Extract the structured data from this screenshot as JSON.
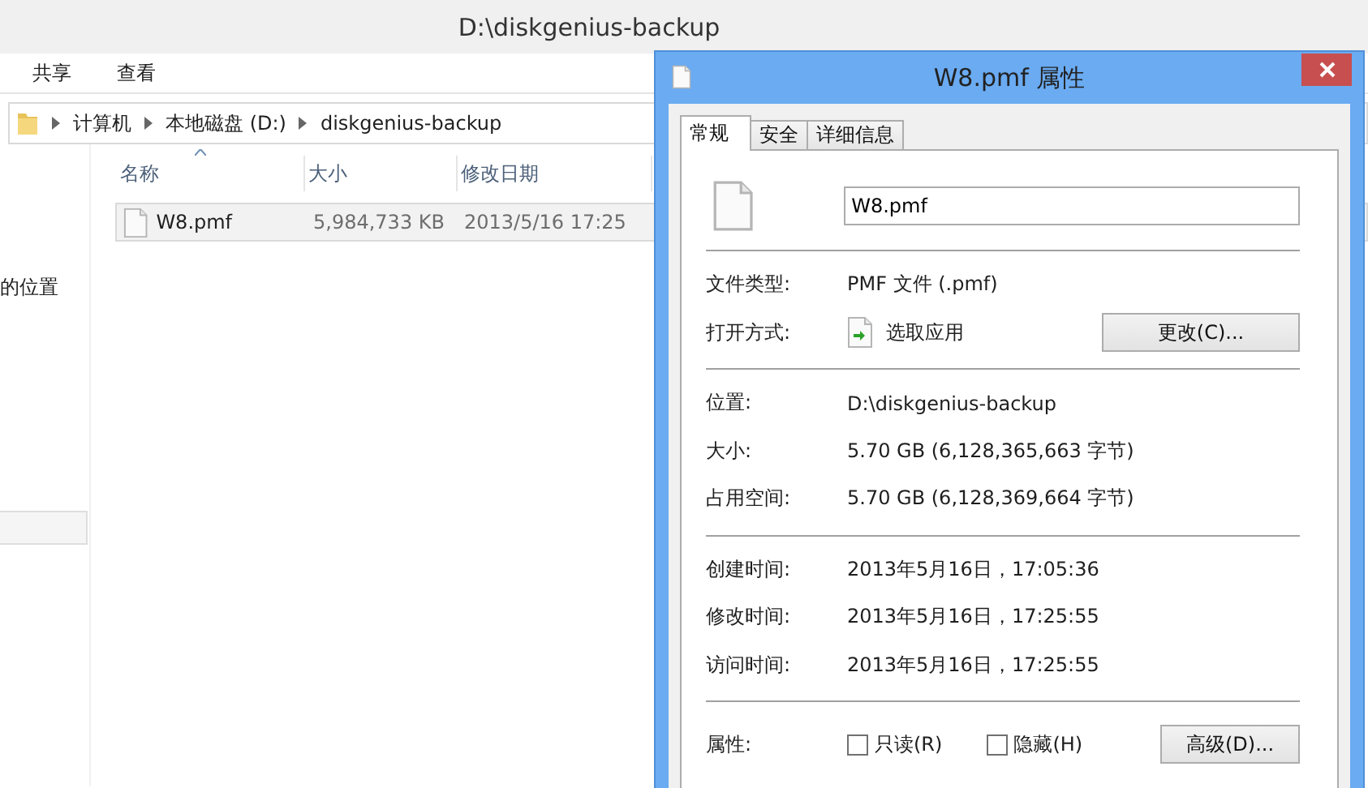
{
  "explorer": {
    "title": "D:\\diskgenius-backup",
    "ribbon_tabs": [
      "共享",
      "查看"
    ],
    "breadcrumb": [
      "计算机",
      "本地磁盘 (D:)",
      "diskgenius-backup"
    ],
    "nav_items": [
      {
        "label": "的位置"
      }
    ],
    "columns": [
      {
        "label": "名称",
        "sorted": true
      },
      {
        "label": "大小",
        "sorted": false
      },
      {
        "label": "修改日期",
        "sorted": false
      }
    ],
    "rows": [
      {
        "name": "W8.pmf",
        "size": "5,984,733 KB",
        "date": "2013/5/16 17:25",
        "selected": true
      }
    ]
  },
  "dialog": {
    "title": "W8.pmf 属性",
    "tabs": [
      {
        "label": "常规",
        "selected": true
      },
      {
        "label": "安全",
        "selected": false
      },
      {
        "label": "详细信息",
        "selected": false
      }
    ],
    "file_name": "W8.pmf",
    "sections": [
      [
        {
          "kind": "text",
          "label": "文件类型:",
          "value": "PMF 文件 (.pmf)"
        },
        {
          "kind": "open_with",
          "label": "打开方式:",
          "value": "选取应用",
          "button": "更改(C)..."
        }
      ],
      [
        {
          "kind": "text",
          "label": "位置:",
          "value": "D:\\diskgenius-backup"
        },
        {
          "kind": "text",
          "label": "大小:",
          "value": "5.70 GB (6,128,365,663 字节)"
        },
        {
          "kind": "text",
          "label": "占用空间:",
          "value": "5.70 GB (6,128,369,664 字节)"
        }
      ],
      [
        {
          "kind": "text",
          "label": "创建时间:",
          "value": "2013年5月16日，17:05:36"
        },
        {
          "kind": "text",
          "label": "修改时间:",
          "value": "2013年5月16日，17:25:55"
        },
        {
          "kind": "text",
          "label": "访问时间:",
          "value": "2013年5月16日，17:25:55"
        }
      ],
      [
        {
          "kind": "attributes",
          "label": "属性:",
          "checkboxes": [
            {
              "label": "只读(R)",
              "checked": false
            },
            {
              "label": "隐藏(H)",
              "checked": false
            }
          ],
          "button": "高级(D)..."
        }
      ]
    ]
  }
}
